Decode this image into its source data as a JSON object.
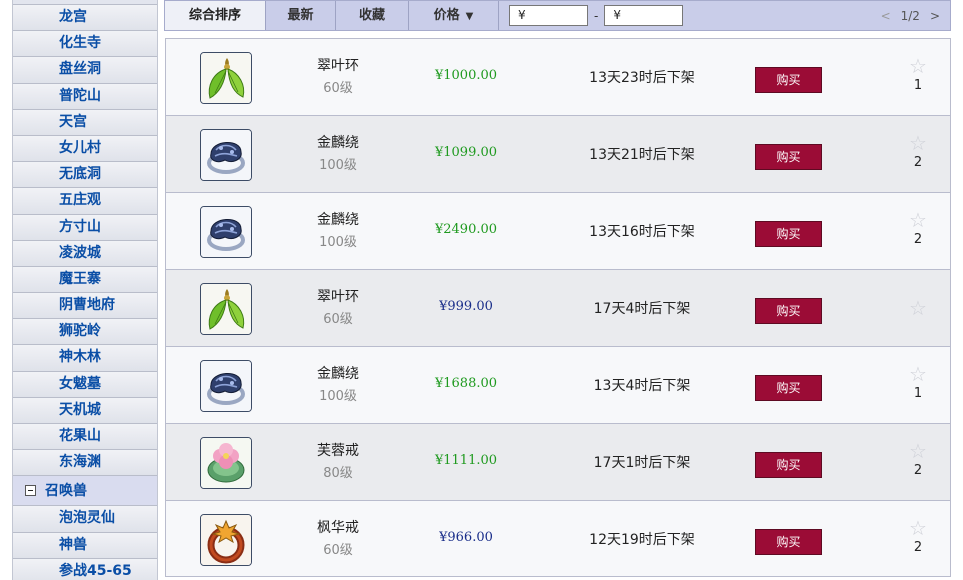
{
  "sidebar": {
    "items": [
      "龙宫",
      "化生寺",
      "盘丝洞",
      "普陀山",
      "天宫",
      "女儿村",
      "无底洞",
      "五庄观",
      "方寸山",
      "凌波城",
      "魔王寨",
      "阴曹地府",
      "狮驼岭",
      "神木林",
      "女魃墓",
      "天机城",
      "花果山",
      "东海渊"
    ],
    "category": "召唤兽",
    "sub_items": [
      "泡泡灵仙",
      "神兽",
      "参战45-65"
    ]
  },
  "toolbar": {
    "tabs": [
      "综合排序",
      "最新",
      "收藏",
      "价格"
    ],
    "price_min": "¥",
    "price_max": "¥",
    "dash": "-",
    "page": "1/2",
    "prev": "<",
    "next": ">"
  },
  "buy_label": "购买",
  "listings": [
    {
      "name": "翠叶环",
      "level": "60级",
      "price": "¥1000.00",
      "price_color": "#1f9a1f",
      "time": "13天23时后下架",
      "fav": "1",
      "icon": "jade-leaf-ring-icon"
    },
    {
      "name": "金麟绕",
      "level": "100级",
      "price": "¥1099.00",
      "price_color": "#1f9a1f",
      "time": "13天21时后下架",
      "fav": "2",
      "icon": "dragon-ring-icon"
    },
    {
      "name": "金麟绕",
      "level": "100级",
      "price": "¥2490.00",
      "price_color": "#1f9a1f",
      "time": "13天16时后下架",
      "fav": "2",
      "icon": "dragon-ring-icon"
    },
    {
      "name": "翠叶环",
      "level": "60级",
      "price": "¥999.00",
      "price_color": "#1a2e8a",
      "time": "17天4时后下架",
      "fav": "",
      "icon": "jade-leaf-ring-icon"
    },
    {
      "name": "金麟绕",
      "level": "100级",
      "price": "¥1688.00",
      "price_color": "#1f9a1f",
      "time": "13天4时后下架",
      "fav": "1",
      "icon": "dragon-ring-icon"
    },
    {
      "name": "芙蓉戒",
      "level": "80级",
      "price": "¥1111.00",
      "price_color": "#1f9a1f",
      "time": "17天1时后下架",
      "fav": "2",
      "icon": "lotus-ring-icon"
    },
    {
      "name": "枫华戒",
      "level": "60级",
      "price": "¥966.00",
      "price_color": "#1a2e8a",
      "time": "12天19时后下架",
      "fav": "2",
      "icon": "maple-ring-icon"
    }
  ]
}
